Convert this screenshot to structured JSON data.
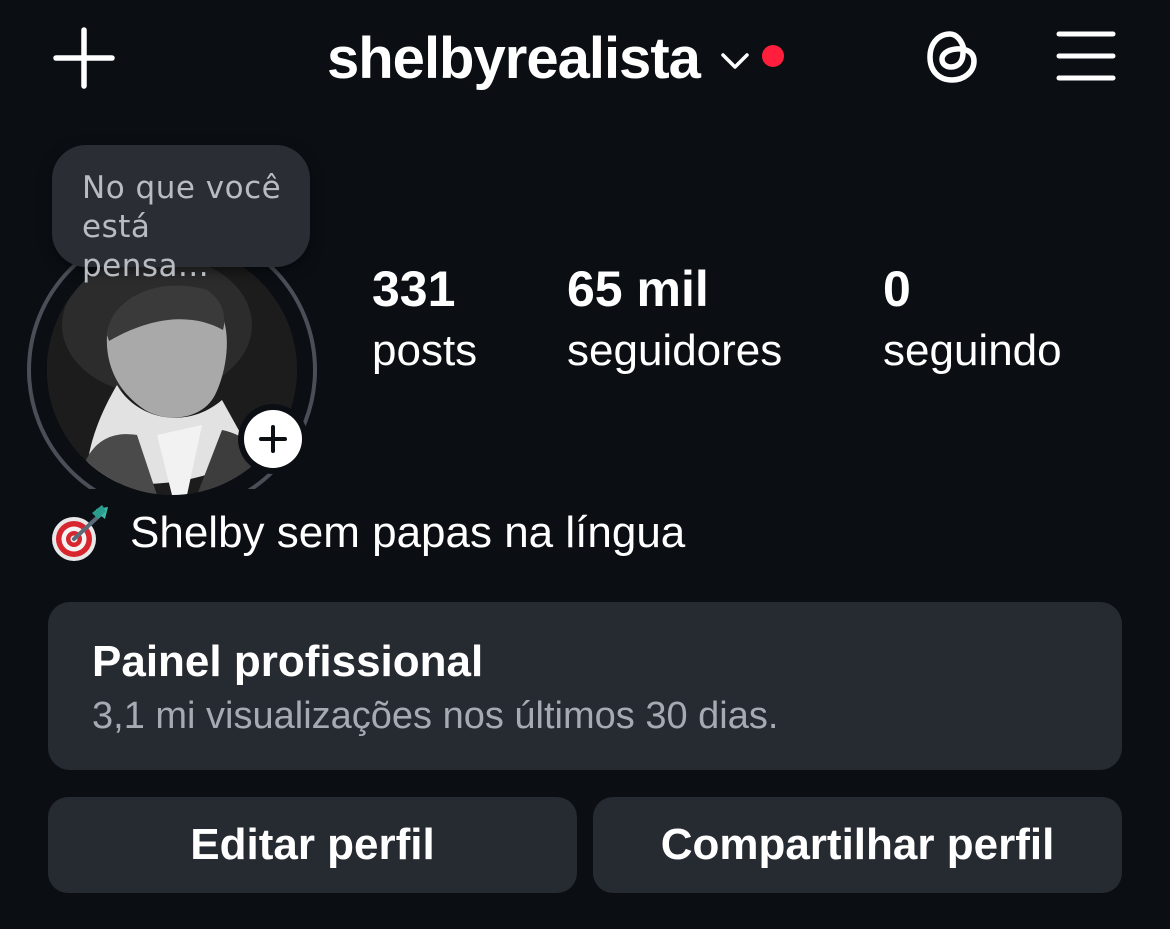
{
  "header": {
    "username": "shelbyrealista",
    "create_icon": "plus-icon",
    "switch_icon": "chevron-down-icon",
    "notification_color": "#ff1f3d",
    "threads_icon": "threads-icon",
    "menu_icon": "hamburger-menu-icon"
  },
  "profile": {
    "note_placeholder": "No que você está pensa...",
    "add_story_icon": "plus-icon",
    "stats": [
      {
        "value": "331",
        "label": "posts"
      },
      {
        "value": "65 mil",
        "label": "seguidores"
      },
      {
        "value": "0",
        "label": "seguindo"
      }
    ],
    "bio_emoji": "direct-hit-dart-icon",
    "bio": "Shelby sem papas na língua"
  },
  "dashboard": {
    "title": "Painel profissional",
    "subtitle": "3,1 mi visualizações nos últimos 30 dias."
  },
  "actions": {
    "edit_label": "Editar perfil",
    "share_label": "Compartilhar perfil"
  },
  "theme": {
    "background": "#0b0f14",
    "card": "#262a31",
    "text": "#ffffff",
    "muted": "#a6abb3"
  }
}
